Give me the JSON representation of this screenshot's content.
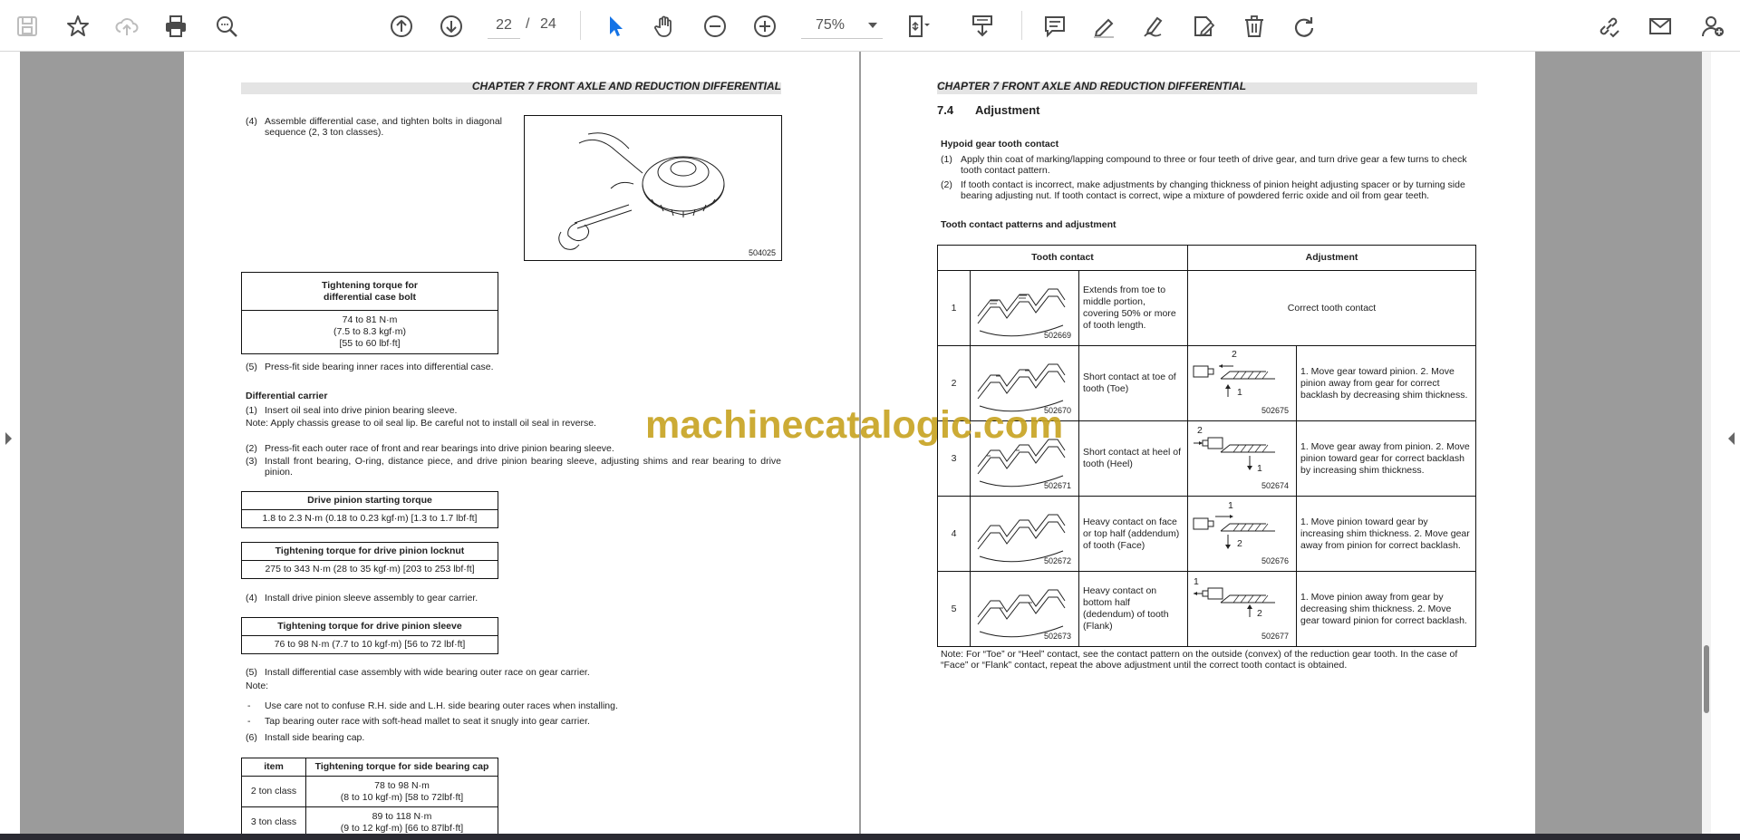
{
  "toolbar": {
    "page_current": "22",
    "page_separator": "/",
    "page_total": "24",
    "zoom": "75%",
    "icons": [
      "save-icon",
      "bookmark-star-icon",
      "cloud-upload-icon",
      "print-icon",
      "zoom-search-icon",
      "page-up-icon",
      "page-down-icon",
      "select-cursor-icon",
      "hand-tool-icon",
      "zoom-out-icon",
      "zoom-in-icon",
      "page-fit-icon",
      "scroll-mode-icon",
      "comment-icon",
      "highlight-pen-icon",
      "draw-pen-icon",
      "fill-sign-icon",
      "delete-icon",
      "rotate-icon",
      "share-link-icon",
      "email-icon",
      "account-icon"
    ],
    "accent": "#1473e6"
  },
  "left_page": {
    "chapter": "CHAPTER 7 FRONT AXLE AND REDUCTION DIFFERENTIAL",
    "step4_num": "(4)",
    "step4_text": "Assemble differential case, and tighten bolts in diagonal sequence (2, 3 ton classes).",
    "figure_code": "504025",
    "table1": {
      "header_line1": "Tightening torque for",
      "header_line2": "differential case bolt",
      "value_line1": "74 to 81 N·m",
      "value_line2": "(7.5 to 8.3 kgf·m)",
      "value_line3": "[55 to 60 lbf·ft]"
    },
    "step5_num": "(5)",
    "step5_text": "Press-fit side bearing inner races into differential case.",
    "diff_heading": "Differential carrier",
    "dc1_num": "(1)",
    "dc1_text": "Insert oil seal into drive pinion bearing sleeve.",
    "note1": "Note: Apply chassis grease to oil seal lip. Be careful not to install oil seal in reverse.",
    "dc2_num": "(2)",
    "dc2_text": "Press-fit each outer race of front and rear bearings into drive pinion bearing sleeve.",
    "dc3_num": "(3)",
    "dc3_text": "Install front bearing, O-ring, distance piece, and drive pinion bearing sleeve, adjusting shims and rear bearing to drive pinion.",
    "table2": {
      "header": "Drive pinion starting torque",
      "value": "1.8 to 2.3 N·m (0.18 to 0.23 kgf·m) [1.3 to 1.7 lbf·ft]"
    },
    "table3": {
      "header": "Tightening torque for drive pinion locknut",
      "value": "275 to 343 N·m (28 to 35 kgf·m) [203 to 253 lbf·ft]"
    },
    "dc4_num": "(4)",
    "dc4_text": "Install drive pinion sleeve assembly to gear carrier.",
    "table4": {
      "header": "Tightening torque for drive pinion sleeve",
      "value": "76 to 98 N·m (7.7 to 10 kgf·m) [56 to 72 lbf·ft]"
    },
    "dc5_num": "(5)",
    "dc5_text": "Install differential case assembly with wide bearing outer race on gear carrier.",
    "note2": "Note:",
    "dash1": "-",
    "dash1_text": "Use care not to confuse R.H. side and L.H. side bearing outer races when installing.",
    "dash2": "-",
    "dash2_text": "Tap bearing outer race with soft-head mallet to seat it snugly into gear carrier.",
    "dc6_num": "(6)",
    "dc6_text": "Install side bearing cap.",
    "table5": {
      "col1": "item",
      "col2": "Tightening torque for side bearing cap",
      "row1_item": "2 ton class",
      "row1_line1": "78 to 98 N·m",
      "row1_line2": "(8 to 10 kgf·m) [58 to 72lbf·ft]",
      "row2_item": "3 ton class",
      "row2_line1": "89 to 118 N·m",
      "row2_line2": "(9 to 12 kgf·m) [66 to 87lbf·ft]"
    }
  },
  "right_page": {
    "chapter": "CHAPTER 7 FRONT AXLE AND REDUCTION DIFFERENTIAL",
    "section_num": "7.4",
    "section_title": "Adjustment",
    "hypoid_heading": "Hypoid gear tooth contact",
    "h1_num": "(1)",
    "h1_text": "Apply thin coat of marking/lapping compound to three or four teeth of drive gear, and turn drive gear a few turns to check tooth contact pattern.",
    "h2_num": "(2)",
    "h2_text": "If tooth contact is incorrect, make adjustments by changing thickness of pinion height adjusting spacer or by turning side bearing adjusting nut. If tooth contact is correct, wipe a mixture of powdered ferric oxide and oil from gear teeth.",
    "patterns_heading": "Tooth contact patterns and adjustment",
    "col_contact": "Tooth contact",
    "col_adjust": "Adjustment",
    "rows": [
      {
        "num": "1",
        "img_code": "502669",
        "desc": "Extends from toe to middle portion, covering 50% or more of tooth length.",
        "adj_code": "",
        "adj": "Correct tooth contact"
      },
      {
        "num": "2",
        "img_code": "502670",
        "desc": "Short contact at toe of tooth (Toe)",
        "adj_code": "502675",
        "adj": "1. Move gear toward pinion. 2. Move pinion away from gear for correct backlash by decreasing shim thickness."
      },
      {
        "num": "3",
        "img_code": "502671",
        "desc": "Short contact at heel of tooth (Heel)",
        "adj_code": "502674",
        "adj": "1. Move gear away from pinion. 2. Move pinion toward gear for correct backlash by increasing shim thickness."
      },
      {
        "num": "4",
        "img_code": "502672",
        "desc": "Heavy contact on face or top half (addendum) of tooth (Face)",
        "adj_code": "502676",
        "adj": "1. Move pinion toward gear by increasing shim thickness. 2. Move gear away from pinion for correct backlash."
      },
      {
        "num": "5",
        "img_code": "502673",
        "desc": "Heavy contact on bottom half (dedendum) of tooth (Flank)",
        "adj_code": "502677",
        "adj": "1. Move pinion away from gear by decreasing shim thickness. 2. Move gear toward pinion for correct backlash."
      }
    ],
    "arrow_labels": [
      "2",
      "1",
      "2",
      "1",
      "1",
      "2",
      "1",
      "2"
    ],
    "note": "Note: For “Toe” or “Heel” contact, see the contact pattern on the outside (convex) of the reduction gear tooth. In the case of “Face” or “Flank” contact, repeat the above adjustment until the correct tooth contact is obtained."
  },
  "watermark": "machinecatalogic.com"
}
